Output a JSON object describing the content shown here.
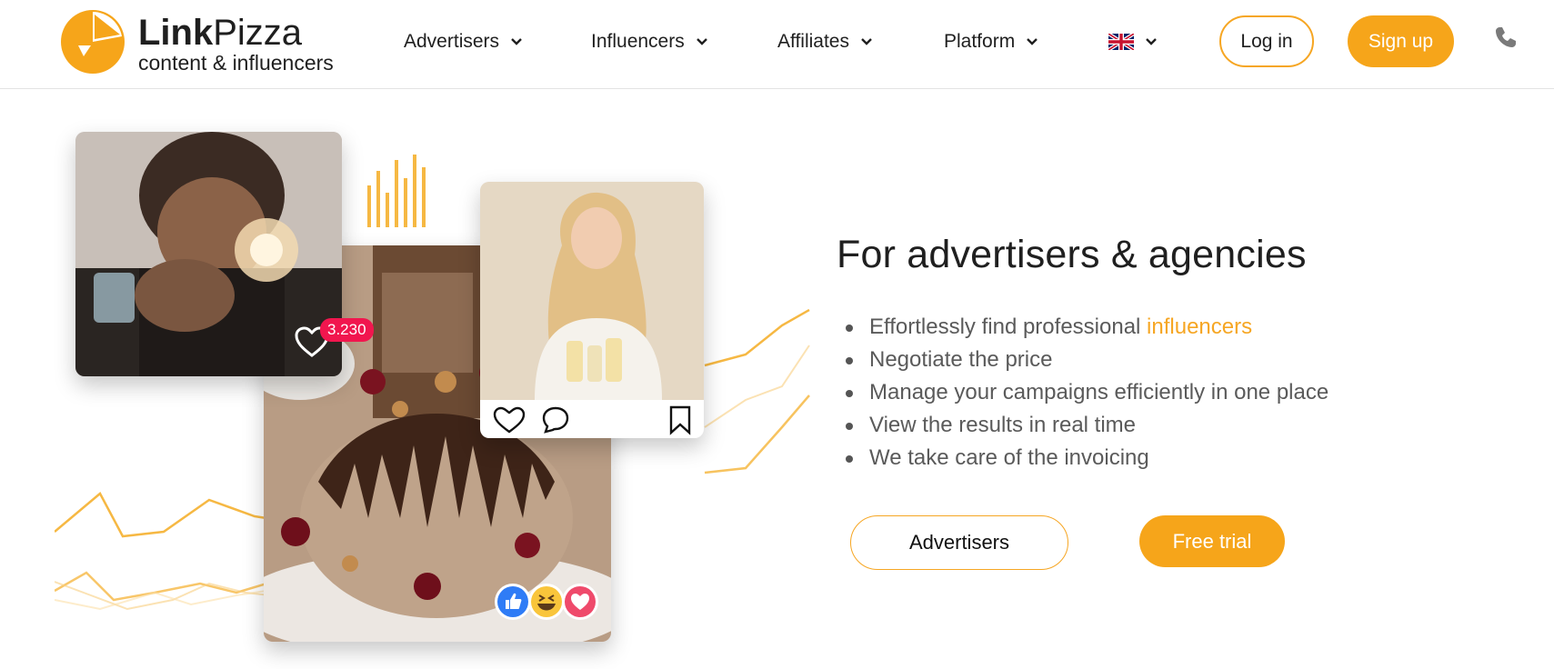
{
  "header": {
    "logo": {
      "name_bold": "Link",
      "name_light": "Pizza",
      "tagline": "content & influencers",
      "icon": "pizza-slice-logo-icon"
    },
    "nav": [
      {
        "label": "Advertisers",
        "icon": "chevron-down-icon"
      },
      {
        "label": "Influencers",
        "icon": "chevron-down-icon"
      },
      {
        "label": "Affiliates",
        "icon": "chevron-down-icon"
      },
      {
        "label": "Platform",
        "icon": "chevron-down-icon"
      }
    ],
    "language": {
      "icon": "uk-flag-icon",
      "chevron": "chevron-down-icon"
    },
    "login_label": "Log in",
    "signup_label": "Sign up",
    "phone_icon": "phone-icon"
  },
  "hero": {
    "like_count": "3.230",
    "title": "For advertisers & agencies",
    "bullets": [
      {
        "text": "Effortlessly find professional ",
        "link": "influencers"
      },
      {
        "text": "Negotiate the price"
      },
      {
        "text": "Manage your campaigns efficiently in one place"
      },
      {
        "text": "View the results in real time"
      },
      {
        "text": "We take care of the invoicing"
      }
    ],
    "advertisers_button": "Advertisers",
    "trial_button": "Free trial",
    "images": {
      "man": "man-with-perfume-photo",
      "dessert": "dessert-photo",
      "woman": "woman-with-product-photo"
    },
    "reactions": [
      "thumbs-up-icon",
      "laughing-emoji-icon",
      "heart-reaction-icon"
    ],
    "post_icons": [
      "heart-icon",
      "comment-icon",
      "bookmark-icon"
    ]
  },
  "colors": {
    "accent": "#f6a623",
    "badge": "#f1164e",
    "text": "#1f1f1f",
    "muted": "#5a5a5a"
  }
}
